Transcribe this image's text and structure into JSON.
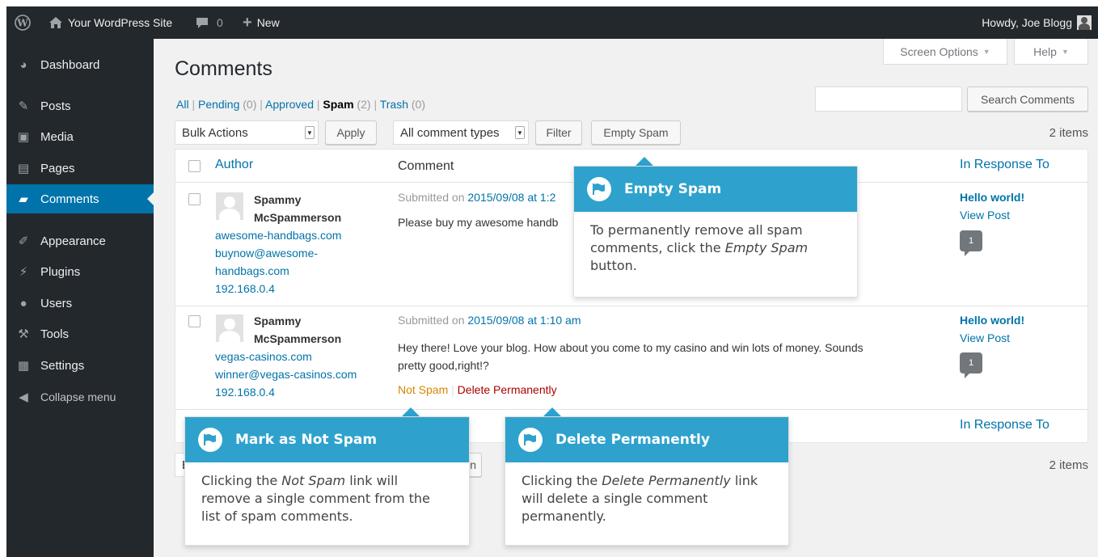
{
  "adminbar": {
    "site_name": "Your WordPress Site",
    "comments_count": "0",
    "new_label": "New",
    "howdy": "Howdy, Joe Blogg"
  },
  "sidebar": {
    "items": [
      {
        "label": "Dashboard",
        "icon": "dashboard-icon"
      },
      {
        "label": "Posts",
        "icon": "pin-icon"
      },
      {
        "label": "Media",
        "icon": "media-icon"
      },
      {
        "label": "Pages",
        "icon": "pages-icon"
      },
      {
        "label": "Comments",
        "icon": "comment-icon"
      },
      {
        "label": "Appearance",
        "icon": "brush-icon"
      },
      {
        "label": "Plugins",
        "icon": "plug-icon"
      },
      {
        "label": "Users",
        "icon": "users-icon"
      },
      {
        "label": "Tools",
        "icon": "wrench-icon"
      },
      {
        "label": "Settings",
        "icon": "settings-icon"
      },
      {
        "label": "Collapse menu",
        "icon": "collapse-icon"
      }
    ],
    "active": "Comments"
  },
  "screen_options": "Screen Options",
  "help": "Help",
  "page_title": "Comments",
  "filters": {
    "all": "All",
    "pending": "Pending",
    "pending_count": "(0)",
    "approved": "Approved",
    "spam": "Spam",
    "spam_count": "(2)",
    "trash": "Trash",
    "trash_count": "(0)"
  },
  "search_button": "Search Comments",
  "search_value": "",
  "bulk_actions": "Bulk Actions",
  "apply": "Apply",
  "comment_types": "All comment types",
  "filter": "Filter",
  "empty_spam": "Empty Spam",
  "items_count": "2 items",
  "columns": {
    "author": "Author",
    "comment": "Comment",
    "in_response_to": "In Response To"
  },
  "comments": [
    {
      "author_first": "Spammy",
      "author_last": "McSpammerson",
      "url": "awesome-handbags.com",
      "email_1": "buynow@awesome-",
      "email_2": "handbags.com",
      "ip": "192.168.0.4",
      "submitted_prefix": "Submitted on",
      "submitted_date": "2015/09/08 at 1:2",
      "text": "Please buy my awesome handb",
      "post": "Hello world!",
      "view_post": "View Post",
      "count": "1"
    },
    {
      "author_first": "Spammy",
      "author_last": "McSpammerson",
      "url": "vegas-casinos.com",
      "email": "winner@vegas-casinos.com",
      "ip": "192.168.0.4",
      "submitted_prefix": "Submitted on",
      "submitted_date": "2015/09/08 at 1:10 am",
      "text_1": "Hey there! Love your blog. How about you come to my casino and win lots of money. Sounds",
      "text_2": "pretty good,right!?",
      "not_spam": "Not Spam",
      "sep": "|",
      "delete": "Delete Permanently",
      "post": "Hello world!",
      "view_post": "View Post",
      "count": "1"
    }
  ],
  "bottom_bulk_partial": "B",
  "bottom_btn_partial": "n",
  "pointers": {
    "empty_spam": {
      "title": "Empty Spam",
      "line1": "To permanently remove all spam",
      "line2_pre": "comments, click the ",
      "line2_em": "Empty Spam",
      "line3": "button."
    },
    "not_spam": {
      "title": "Mark as Not Spam",
      "line1_pre": "Clicking the ",
      "line1_em": "Not Spam",
      "line1_post": " link will",
      "line2": "remove a single comment from the",
      "line3": "list of spam comments."
    },
    "delete": {
      "title": "Delete Permanently",
      "line1_pre": "Clicking the ",
      "line1_em": "Delete Permanently",
      "line1_post": " link",
      "line2": "will delete a single comment",
      "line3": "permanently."
    }
  },
  "colors": {
    "accent": "#0073aa",
    "pointer": "#2ea2cc",
    "not_spam": "#d98500",
    "delete": "#a00",
    "adminbar": "#23282d"
  }
}
